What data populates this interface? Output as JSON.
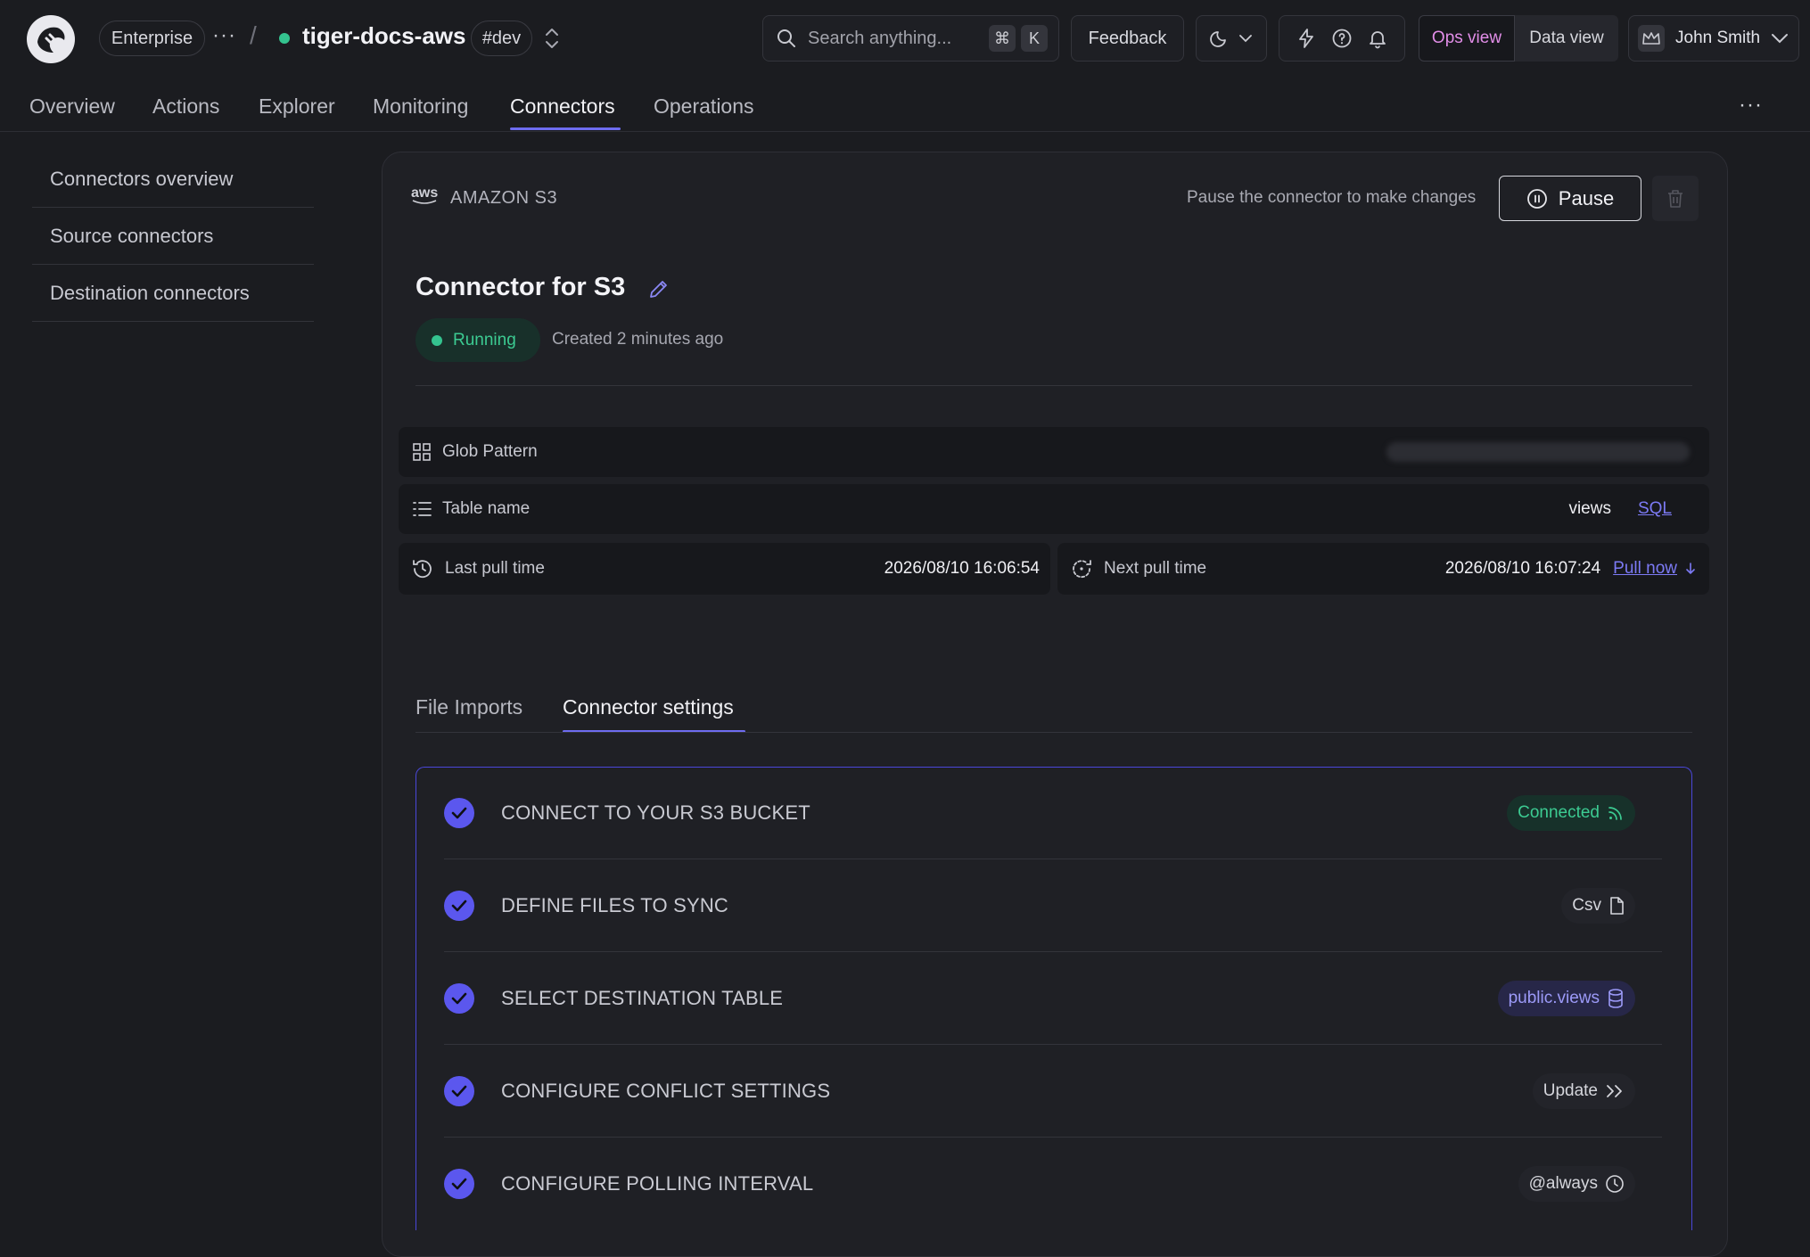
{
  "topbar": {
    "org": "Enterprise",
    "more": "···",
    "separator": "/",
    "project_name": "tiger-docs-aws",
    "env_tag": "#dev",
    "search_placeholder": "Search anything...",
    "shortcut_cmd": "⌘",
    "shortcut_key": "K",
    "feedback": "Feedback",
    "ops_view": "Ops view",
    "data_view": "Data view",
    "user_name": "John Smith"
  },
  "nav": {
    "tabs": [
      "Overview",
      "Actions",
      "Explorer",
      "Monitoring",
      "Connectors",
      "Operations"
    ],
    "active": "Connectors",
    "more": "···"
  },
  "sidebar": {
    "items": [
      "Connectors overview",
      "Source connectors",
      "Destination connectors"
    ]
  },
  "connector": {
    "provider_logo": "aws",
    "provider": "AMAZON S3",
    "pause_hint": "Pause the connector to make changes",
    "pause_label": "Pause",
    "title": "Connector for S3",
    "status": "Running",
    "created": "Created 2 minutes ago",
    "status_color": "#34c38f",
    "accent": "#6e6cf0"
  },
  "details": {
    "glob_label": "Glob Pattern",
    "table_label": "Table name",
    "table_value": "views",
    "table_link": "SQL",
    "last_pull_label": "Last pull time",
    "last_pull_value": "2026/08/10 16:06:54",
    "next_pull_label": "Next pull time",
    "next_pull_value": "2026/08/10 16:07:24",
    "pull_now": "Pull now"
  },
  "tabs": {
    "items": [
      "File Imports",
      "Connector settings"
    ],
    "active": "Connector settings"
  },
  "steps": [
    {
      "title": "CONNECT TO YOUR S3 BUCKET",
      "badge": "Connected",
      "icon": "rss-icon"
    },
    {
      "title": "DEFINE FILES TO SYNC",
      "badge": "Csv",
      "icon": "file-icon"
    },
    {
      "title": "SELECT DESTINATION TABLE",
      "badge": "public.views",
      "icon": "database-icon"
    },
    {
      "title": "CONFIGURE CONFLICT SETTINGS",
      "badge": "Update",
      "icon": "chevrons-right-icon"
    },
    {
      "title": "CONFIGURE POLLING INTERVAL",
      "badge": "@always",
      "icon": "clock-icon"
    }
  ]
}
